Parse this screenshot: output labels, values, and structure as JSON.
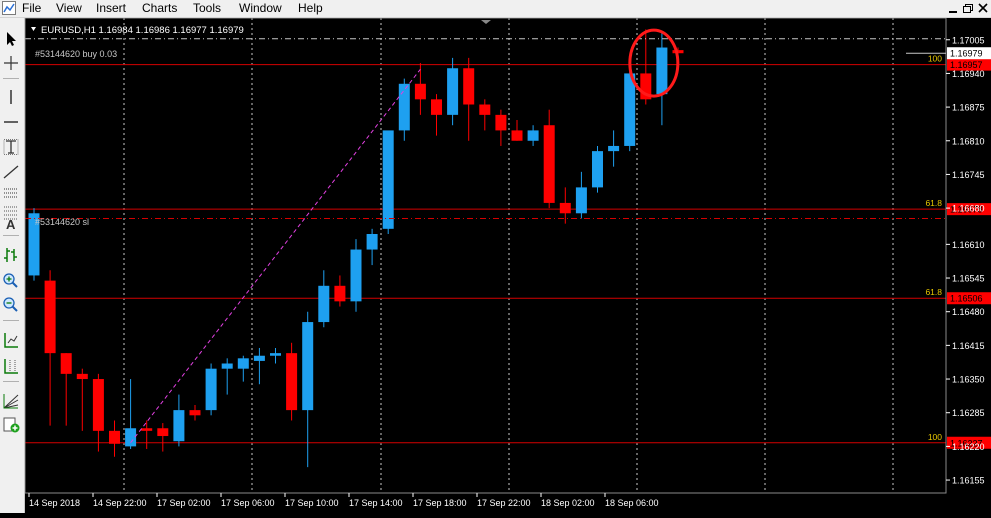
{
  "menu": [
    "File",
    "View",
    "Insert",
    "Charts",
    "Tools",
    "Window",
    "Help"
  ],
  "chart_header": "EURUSD,H1  1.16984 1.16986 1.16977 1.16979",
  "order_label": "#53144620 buy 0.03",
  "sl_label": "#53144620 sl",
  "colors": {
    "bull": "#1ea0f0",
    "bear": "#ff0000",
    "grid": "#c8c8c8",
    "fib": "#d40000",
    "fibtext": "#e8c800",
    "axis": "#ffffff"
  },
  "toolbar_icons": [
    "cursor-icon",
    "crosshair-icon",
    "vertical-line-icon",
    "horizontal-line-icon",
    "text-label-icon",
    "trendline-icon",
    "equidistant-channel-icon",
    "fibonacci-icon",
    "text-icon",
    "chart-bars-icon",
    "zoom-in-icon",
    "zoom-out-icon",
    "tile-windows-icon",
    "period-separators-icon",
    "fibonacci-fan-icon",
    "new-order-icon"
  ],
  "chart_data": {
    "type": "candlestick",
    "symbol": "EURUSD",
    "timeframe": "H1",
    "yticks": [
      "1.17005",
      "1.16940",
      "1.16875",
      "1.16810",
      "1.16745",
      "1.16680",
      "1.16610",
      "1.16545",
      "1.16480",
      "1.16415",
      "1.16350",
      "1.16285",
      "1.16220",
      "1.16155"
    ],
    "ytick_values": [
      1.17005,
      1.1694,
      1.16875,
      1.1681,
      1.16745,
      1.1668,
      1.1661,
      1.16545,
      1.1648,
      1.16415,
      1.1635,
      1.16285,
      1.1622,
      1.16155
    ],
    "ylim": [
      1.1613,
      1.17047
    ],
    "xticks": [
      "14 Sep 2018",
      "14 Sep 22:00",
      "17 Sep 02:00",
      "17 Sep 06:00",
      "17 Sep 10:00",
      "17 Sep 14:00",
      "17 Sep 18:00",
      "17 Sep 22:00",
      "18 Sep 02:00",
      "18 Sep 06:00"
    ],
    "current_price": {
      "label": "1.16979",
      "value": 1.16979
    },
    "levels": [
      {
        "label": "100",
        "price_label": "1.16957",
        "value": 1.16957
      },
      {
        "label": "61.8",
        "price_label": "1.16678",
        "value": 1.16678
      },
      {
        "label": "61.8",
        "price_label": "1.16506",
        "value": 1.16506
      },
      {
        "label": "100",
        "price_label": "1.16227",
        "value": 1.16227
      }
    ],
    "candles": [
      {
        "o": 1.1655,
        "h": 1.1668,
        "l": 1.1654,
        "c": 1.1667
      },
      {
        "o": 1.1654,
        "h": 1.1656,
        "l": 1.1626,
        "c": 1.164
      },
      {
        "o": 1.164,
        "h": 1.164,
        "l": 1.1626,
        "c": 1.1636
      },
      {
        "o": 1.1636,
        "h": 1.1637,
        "l": 1.1625,
        "c": 1.1635
      },
      {
        "o": 1.1635,
        "h": 1.1636,
        "l": 1.1621,
        "c": 1.1625
      },
      {
        "o": 1.1625,
        "h": 1.1627,
        "l": 1.162,
        "c": 1.16225
      },
      {
        "o": 1.1622,
        "h": 1.1635,
        "l": 1.16215,
        "c": 1.16255
      },
      {
        "o": 1.16255,
        "h": 1.1627,
        "l": 1.16215,
        "c": 1.1625
      },
      {
        "o": 1.16255,
        "h": 1.16265,
        "l": 1.1621,
        "c": 1.1624
      },
      {
        "o": 1.1623,
        "h": 1.1632,
        "l": 1.1622,
        "c": 1.1629
      },
      {
        "o": 1.1629,
        "h": 1.163,
        "l": 1.1627,
        "c": 1.1628
      },
      {
        "o": 1.1629,
        "h": 1.1638,
        "l": 1.1628,
        "c": 1.1637
      },
      {
        "o": 1.1637,
        "h": 1.1639,
        "l": 1.1632,
        "c": 1.1638
      },
      {
        "o": 1.1637,
        "h": 1.16395,
        "l": 1.16345,
        "c": 1.1639
      },
      {
        "o": 1.16385,
        "h": 1.1641,
        "l": 1.1634,
        "c": 1.16395
      },
      {
        "o": 1.16395,
        "h": 1.1641,
        "l": 1.1638,
        "c": 1.164
      },
      {
        "o": 1.164,
        "h": 1.1642,
        "l": 1.1627,
        "c": 1.1629
      },
      {
        "o": 1.1629,
        "h": 1.1648,
        "l": 1.1618,
        "c": 1.1646
      },
      {
        "o": 1.1646,
        "h": 1.1656,
        "l": 1.1645,
        "c": 1.1653
      },
      {
        "o": 1.1653,
        "h": 1.1655,
        "l": 1.1649,
        "c": 1.165
      },
      {
        "o": 1.165,
        "h": 1.1662,
        "l": 1.1648,
        "c": 1.166
      },
      {
        "o": 1.166,
        "h": 1.1664,
        "l": 1.1657,
        "c": 1.1663
      },
      {
        "o": 1.1664,
        "h": 1.1682,
        "l": 1.1663,
        "c": 1.1683
      },
      {
        "o": 1.1683,
        "h": 1.1693,
        "l": 1.1681,
        "c": 1.1692
      },
      {
        "o": 1.1692,
        "h": 1.1696,
        "l": 1.1686,
        "c": 1.1689
      },
      {
        "o": 1.1689,
        "h": 1.169,
        "l": 1.1682,
        "c": 1.1686
      },
      {
        "o": 1.1686,
        "h": 1.1697,
        "l": 1.1684,
        "c": 1.1695
      },
      {
        "o": 1.1695,
        "h": 1.1697,
        "l": 1.1681,
        "c": 1.1688
      },
      {
        "o": 1.1688,
        "h": 1.1689,
        "l": 1.1683,
        "c": 1.1686
      },
      {
        "o": 1.1686,
        "h": 1.1687,
        "l": 1.168,
        "c": 1.1683
      },
      {
        "o": 1.1683,
        "h": 1.1685,
        "l": 1.1681,
        "c": 1.1681
      },
      {
        "o": 1.1681,
        "h": 1.1684,
        "l": 1.168,
        "c": 1.1683
      },
      {
        "o": 1.1684,
        "h": 1.1687,
        "l": 1.1668,
        "c": 1.1669
      },
      {
        "o": 1.1669,
        "h": 1.1672,
        "l": 1.1665,
        "c": 1.1667
      },
      {
        "o": 1.1667,
        "h": 1.1675,
        "l": 1.1666,
        "c": 1.1672
      },
      {
        "o": 1.1672,
        "h": 1.168,
        "l": 1.1671,
        "c": 1.1679
      },
      {
        "o": 1.1679,
        "h": 1.1683,
        "l": 1.1676,
        "c": 1.168
      },
      {
        "o": 1.168,
        "h": 1.1696,
        "l": 1.1679,
        "c": 1.1694
      },
      {
        "o": 1.1694,
        "h": 1.17025,
        "l": 1.1688,
        "c": 1.1689
      },
      {
        "o": 1.169,
        "h": 1.1702,
        "l": 1.1684,
        "c": 1.1699
      },
      {
        "o": 1.16985,
        "h": 1.1699,
        "l": 1.16975,
        "c": 1.16979
      }
    ]
  }
}
